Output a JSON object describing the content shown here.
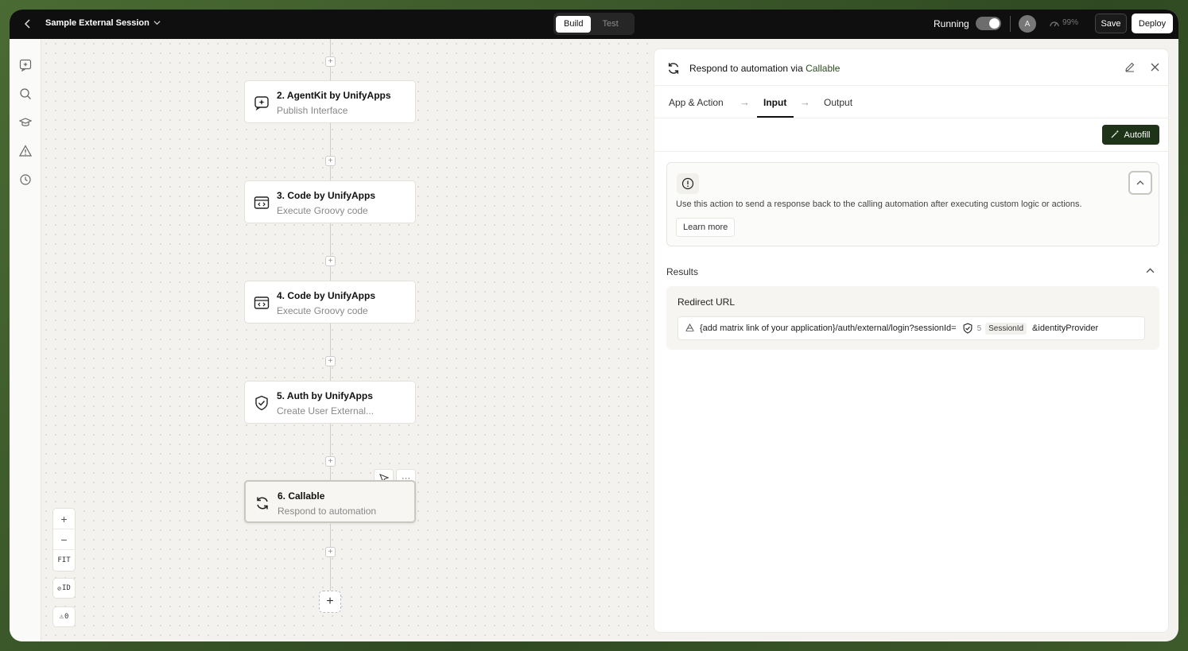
{
  "topbar": {
    "session_title": "Sample External Session",
    "modes": [
      "Build",
      "Test"
    ],
    "active_mode": "Build",
    "running_label": "Running",
    "avatar_initial": "A",
    "gauge_value": "99%",
    "save_label": "Save",
    "deploy_label": "Deploy"
  },
  "rail": {
    "icons": [
      "sparkle-chat-icon",
      "search-icon",
      "graduation-cap-icon",
      "warning-icon",
      "history-icon"
    ]
  },
  "canvas": {
    "nodes": [
      {
        "title": "2. AgentKit by UnifyApps",
        "subtitle": "Publish Interface",
        "icon": "agentkit-icon"
      },
      {
        "title": "3. Code by UnifyApps",
        "subtitle": "Execute Groovy code",
        "icon": "code-icon"
      },
      {
        "title": "4. Code by UnifyApps",
        "subtitle": "Execute Groovy code",
        "icon": "code-icon"
      },
      {
        "title": "5. Auth by UnifyApps",
        "subtitle": "Create User External...",
        "icon": "shield-icon"
      },
      {
        "title": "6. Callable",
        "subtitle": "Respond to automation",
        "icon": "refresh-icon"
      }
    ],
    "zoom": {
      "in": "+",
      "out": "−",
      "fit": "FIT"
    },
    "id_toggle": "ID",
    "warnings_count": "0"
  },
  "panel": {
    "title_prefix": "Respond to automation via",
    "title_accent": "Callable",
    "tabs": [
      "App & Action",
      "Input",
      "Output"
    ],
    "active_tab": "Input",
    "autofill_label": "Autofill",
    "info_text": "Use this action to send a response back to the calling automation after executing custom logic or actions.",
    "learn_more_label": "Learn more",
    "results_label": "Results",
    "redirect_label": "Redirect URL",
    "redirect_value_prefix": "{add matrix link of your application}/auth/external/login?sessionId=",
    "token_step": "5",
    "token_label": "SessionId",
    "redirect_value_suffix": "&identityProvider"
  },
  "colors": {
    "accent_dark_green": "#1e3318",
    "topbar": "#0f0f0f"
  }
}
